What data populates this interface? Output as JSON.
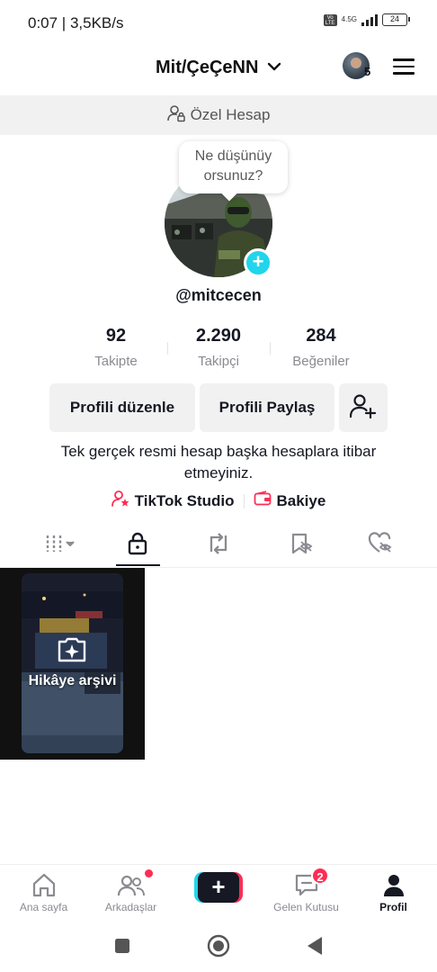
{
  "status_bar": {
    "time": "0:07 | 3,5KB/s",
    "network_label": "4.5G",
    "volte_label": "Vo LTE",
    "battery": "24"
  },
  "header": {
    "account_name": "Mit/ÇeÇeNN",
    "account_count": "5"
  },
  "private_banner": {
    "label": "Özel Hesap"
  },
  "profile": {
    "thought_bubble": "Ne düşünüy orsunuz?",
    "thought_line1": "Ne düşünüy",
    "thought_line2": "orsunuz?",
    "add_symbol": "+",
    "username": "@mitcecen",
    "stats": [
      {
        "value": "92",
        "label": "Takipte"
      },
      {
        "value": "2.290",
        "label": "Takipçi"
      },
      {
        "value": "284",
        "label": "Beğeniler"
      }
    ],
    "buttons": {
      "edit": "Profili düzenle",
      "share": "Profili Paylaş"
    },
    "bio": "Tek gerçek resmi hesap başka hesaplara itibar etmeyiniz.",
    "links": {
      "studio": "TikTok Studio",
      "balance": "Bakiye"
    }
  },
  "tabs": [
    {
      "name": "videos-grid",
      "icon": "grid-icon"
    },
    {
      "name": "private",
      "icon": "lock-icon",
      "active": true
    },
    {
      "name": "reposts",
      "icon": "repost-icon"
    },
    {
      "name": "favorites",
      "icon": "bookmark-hidden-icon"
    },
    {
      "name": "liked",
      "icon": "heart-hidden-icon"
    }
  ],
  "grid": {
    "story_archive_label": "Hikâye arşivi"
  },
  "bottom_nav": {
    "home": "Ana sayfa",
    "friends": "Arkadaşlar",
    "create": "+",
    "inbox": "Gelen Kutusu",
    "inbox_badge": "2",
    "profile": "Profil"
  },
  "colors": {
    "accent_red": "#fe2c55",
    "accent_cyan": "#20d5ec",
    "text_primary": "#161823",
    "text_secondary": "#8a8b91"
  }
}
